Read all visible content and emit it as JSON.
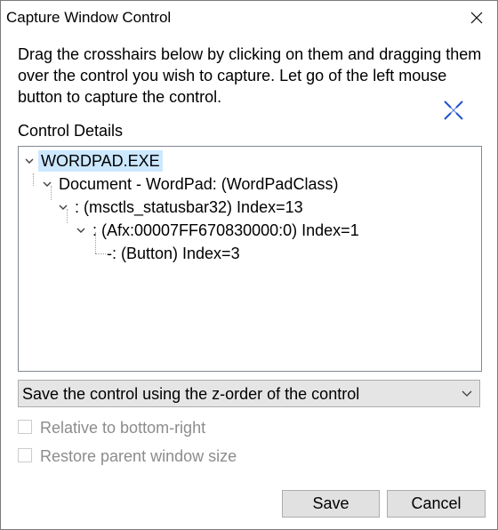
{
  "window": {
    "title": "Capture Window Control"
  },
  "instructions": "Drag the crosshairs below by clicking on them and dragging them over the control you wish to capture. Let go of the left mouse button to capture the control.",
  "control_details_label": "Control Details",
  "tree": {
    "nodes": [
      {
        "label": "WORDPAD.EXE",
        "selected": true
      },
      {
        "label": "Document - WordPad: (WordPadClass)"
      },
      {
        "label": ": (msctls_statusbar32) Index=13"
      },
      {
        "label": ": (Afx:00007FF670830000:0) Index=1"
      },
      {
        "label": "-: (Button) Index=3"
      }
    ]
  },
  "save_mode_dropdown": {
    "selected": "Save the control using the z-order of the control"
  },
  "checkboxes": {
    "relative_bottom_right": {
      "label": "Relative to bottom-right",
      "checked": false,
      "enabled": false
    },
    "restore_parent_size": {
      "label": "Restore parent window size",
      "checked": false,
      "enabled": false
    }
  },
  "buttons": {
    "save": "Save",
    "cancel": "Cancel"
  },
  "colors": {
    "selection": "#cce8ff",
    "crosshair": "#1f4fd1",
    "disabled_text": "#8c8c8c",
    "button_face": "#e1e1e1"
  },
  "icons": {
    "close": "close-icon",
    "crosshair": "crosshair-icon",
    "expander": "chevron-down-icon",
    "dropdown": "chevron-down-icon"
  }
}
